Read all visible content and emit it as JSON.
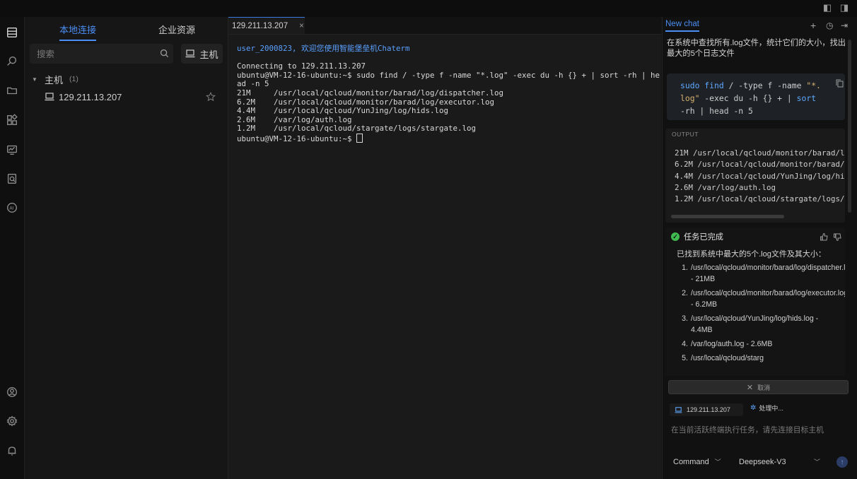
{
  "sidebar": {
    "tabs": [
      "本地连接",
      "企业资源"
    ],
    "search_placeholder": "搜索",
    "host_button": "主机",
    "group_label": "主机",
    "group_count": "(1)",
    "hosts": [
      "129.211.13.207"
    ]
  },
  "terminal": {
    "tab_label": "129.211.13.207",
    "tab_close": "×",
    "lines": [
      "user_2000823, 欢迎您使用智能堡垒机Chaterm",
      "",
      "Connecting to 129.211.13.207",
      "ubuntu@VM-12-16-ubuntu:~$ sudo find / -type f -name \"*.log\" -exec du -h {} + | sort -rh | he",
      "ad -n 5",
      "21M     /usr/local/qcloud/monitor/barad/log/dispatcher.log",
      "6.2M    /usr/local/qcloud/monitor/barad/log/executor.log",
      "4.4M    /usr/local/qcloud/YunJing/log/hids.log",
      "2.6M    /var/log/auth.log",
      "1.2M    /usr/local/qcloud/stargate/logs/stargate.log"
    ],
    "prompt": "ubuntu@VM-12-16-ubuntu:~$ "
  },
  "chat": {
    "tab_label": "New chat",
    "user_message": "在系统中查找所有.log文件，统计它们的大小，找出最大的5个日志文件",
    "code": {
      "line1": [
        "sudo",
        " find",
        " /",
        " -type",
        " f",
        " -name",
        " \"*."
      ],
      "line2": [
        "log\"",
        " -exec",
        " du",
        " -h",
        " {}",
        " +",
        " |",
        " sort"
      ],
      "line3": [
        "-rh",
        " |",
        " head",
        " -n",
        " 5"
      ]
    },
    "output_label": "OUTPUT",
    "output_lines": [
      "21M /usr/local/qcloud/monitor/barad/l",
      "6.2M /usr/local/qcloud/monitor/barad/",
      "4.4M /usr/local/qcloud/YunJing/log/hi",
      "2.6M /var/log/auth.log",
      "1.2M /usr/local/qcloud/stargate/logs/"
    ],
    "status": "任务已完成",
    "summary": "已找到系统中最大的5个.log文件及其大小：",
    "results": [
      {
        "n": "1.",
        "text": "/usr/local/qcloud/monitor/barad/log/dispatcher.log - 21MB"
      },
      {
        "n": "2.",
        "text": "/usr/local/qcloud/monitor/barad/log/executor.log - 6.2MB"
      },
      {
        "n": "3.",
        "text": "/usr/local/qcloud/YunJing/log/hids.log - 4.4MB"
      },
      {
        "n": "4.",
        "text": "/var/log/auth.log - 2.6MB"
      },
      {
        "n": "5.",
        "text": "/usr/local/qcloud/starg"
      }
    ],
    "cancel_label": "取消",
    "host_chip": "129.211.13.207",
    "processing": "处理中...",
    "input_placeholder": "在当前活跃终端执行任务，请先连接目标主机",
    "mode": "Command",
    "model": "Deepseek-V3"
  },
  "colors": {
    "accent": "#4b8ef5",
    "success": "#3fb950",
    "background": "#141414"
  }
}
